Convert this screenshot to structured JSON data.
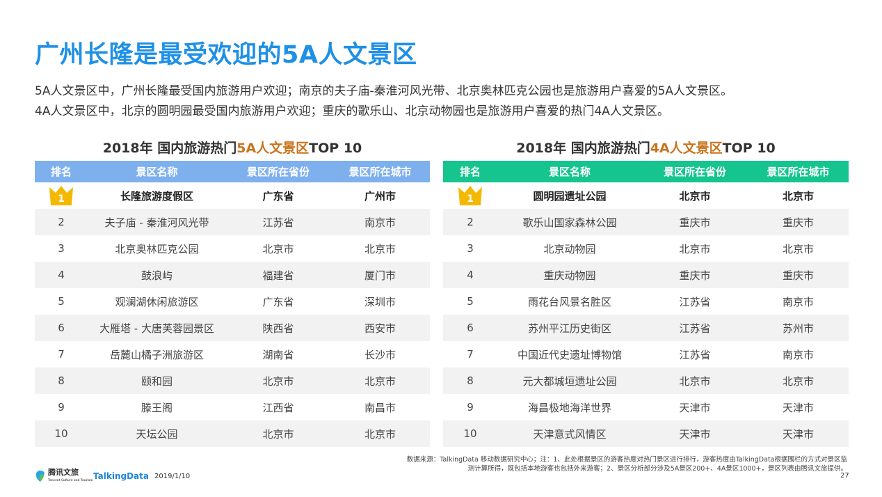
{
  "title": "广州长隆是最受欢迎的5A人文景区",
  "summary": [
    "5A人文景区中，广州长隆最受国内旅游用户欢迎；南京的夫子庙-秦淮河风光带、北京奥林匹克公园也是旅游用户喜爱的5A人文景区。",
    "4A人文景区中，北京的圆明园最受国内旅游用户欢迎；重庆的歌乐山、北京动物园也是旅游用户喜爱的热门4A人文景区。"
  ],
  "colors": {
    "title": "#1e90e6",
    "left_header": "#7fb0ee",
    "right_header": "#15c48e",
    "highlight": "#c8741e",
    "crown": "#f5b800"
  },
  "left_table": {
    "title_pre": "2018年 国内旅游热门",
    "title_hl": "5A人文景区",
    "title_post": "TOP 10",
    "headers": [
      "排名",
      "景区名称",
      "景区所在省份",
      "景区所在城市"
    ],
    "rows": [
      [
        "1",
        "长隆旅游度假区",
        "广东省",
        "广州市"
      ],
      [
        "2",
        "夫子庙 - 秦淮河风光带",
        "江苏省",
        "南京市"
      ],
      [
        "3",
        "北京奥林匹克公园",
        "北京市",
        "北京市"
      ],
      [
        "4",
        "鼓浪屿",
        "福建省",
        "厦门市"
      ],
      [
        "5",
        "观澜湖休闲旅游区",
        "广东省",
        "深圳市"
      ],
      [
        "6",
        "大雁塔 - 大唐芙蓉园景区",
        "陕西省",
        "西安市"
      ],
      [
        "7",
        "岳麓山橘子洲旅游区",
        "湖南省",
        "长沙市"
      ],
      [
        "8",
        "颐和园",
        "北京市",
        "北京市"
      ],
      [
        "9",
        "滕王阁",
        "江西省",
        "南昌市"
      ],
      [
        "10",
        "天坛公园",
        "北京市",
        "北京市"
      ]
    ]
  },
  "right_table": {
    "title_pre": "2018年 国内旅游热门",
    "title_hl": "4A人文景区",
    "title_post": "TOP 10",
    "headers": [
      "排名",
      "景区名称",
      "景区所在省份",
      "景区所在城市"
    ],
    "rows": [
      [
        "1",
        "圆明园遗址公园",
        "北京市",
        "北京市"
      ],
      [
        "2",
        "歌乐山国家森林公园",
        "重庆市",
        "重庆市"
      ],
      [
        "3",
        "北京动物园",
        "北京市",
        "北京市"
      ],
      [
        "4",
        "重庆动物园",
        "重庆市",
        "重庆市"
      ],
      [
        "5",
        "雨花台风景名胜区",
        "江苏省",
        "南京市"
      ],
      [
        "6",
        "苏州平江历史街区",
        "江苏省",
        "苏州市"
      ],
      [
        "7",
        "中国近代史遗址博物馆",
        "江苏省",
        "南京市"
      ],
      [
        "8",
        "元大都城垣遗址公园",
        "北京市",
        "北京市"
      ],
      [
        "9",
        "海昌极地海洋世界",
        "天津市",
        "天津市"
      ],
      [
        "10",
        "天津意式风情区",
        "天津市",
        "天津市"
      ]
    ]
  },
  "source_lines": [
    "数据来源：TalkingData 移动数据研究中心；注：1、此处根据景区的游客热度对热门景区进行排行，游客热度由TalkingData根据围栏的方式对景区监",
    "测计算所得，既包括本地游客也包括外来游客；2、景区分析部分涉及5A景区200+、4A景区1000+，景区列表由腾讯文旅提供。"
  ],
  "footer": {
    "tencent_logo": "腾讯文旅",
    "tencent_sub": "Tencent Culture and Tourism",
    "td_logo": "TalkingData",
    "date": "2019/1/10",
    "page": "27"
  }
}
